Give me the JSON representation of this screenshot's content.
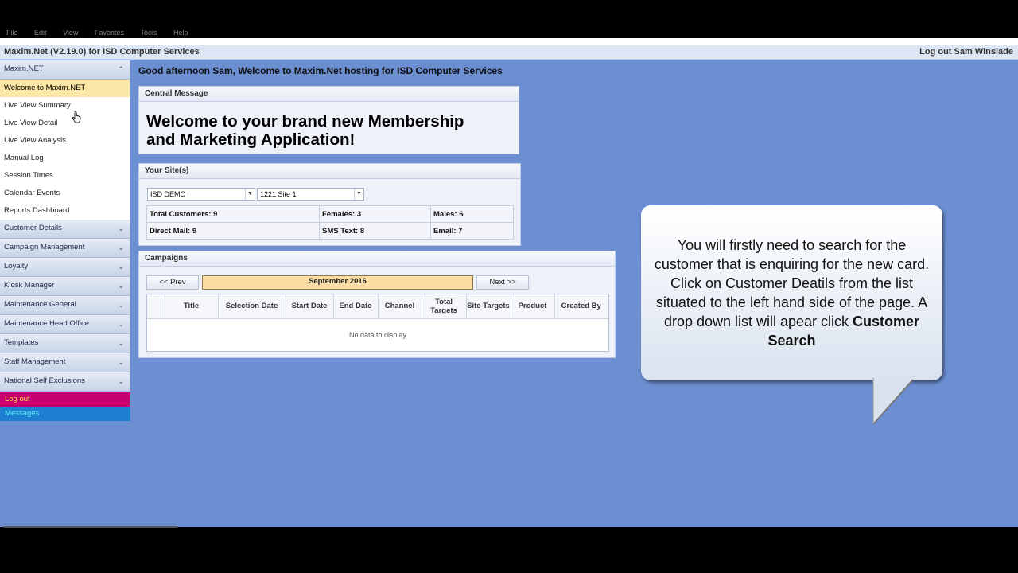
{
  "menubar": [
    "File",
    "Edit",
    "View",
    "Favorites",
    "Tools",
    "Help"
  ],
  "header": {
    "title": "Maxim.Net (V2.19.0) for ISD Computer Services",
    "logout": "Log out Sam Winslade"
  },
  "sidebar": {
    "group_main": "Maxim.NET",
    "items": [
      "Welcome to Maxim.NET",
      "Live View Summary",
      "Live View Detail",
      "Live View Analysis",
      "Manual Log",
      "Session Times",
      "Calendar Events",
      "Reports Dashboard"
    ],
    "active_item": "Welcome to Maxim.NET",
    "groups": [
      "Customer Details",
      "Campaign Management",
      "Loyalty",
      "Kiosk Manager",
      "Maintenance General",
      "Maintenance Head Office",
      "Templates",
      "Staff Management",
      "National Self Exclusions"
    ],
    "logout": "Log out",
    "messages": "Messages"
  },
  "welcome_text": "Good afternoon Sam, Welcome to Maxim.Net hosting for ISD Computer Services",
  "central_message": {
    "title": "Central Message",
    "line1": "Welcome to your brand new Membership",
    "line2": "and Marketing Application!"
  },
  "sites": {
    "title": "Your Site(s)",
    "site_select": "ISD DEMO",
    "subsite_select": "1221 Site 1",
    "total_customers": "Total Customers: 9",
    "females": "Females: 3",
    "males": "Males: 6",
    "direct_mail": "Direct Mail: 9",
    "sms_text": "SMS Text: 8",
    "email": "Email: 7"
  },
  "campaigns": {
    "title": "Campaigns",
    "prev": "<< Prev",
    "month": "September 2016",
    "next": "Next >>",
    "columns": [
      "",
      "Title",
      "Selection Date",
      "Start Date",
      "End Date",
      "Channel",
      "Total Targets",
      "Site Targets",
      "Product",
      "Created By"
    ],
    "no_data": "No data to display"
  },
  "callout": {
    "text": "You will firstly need to search for the customer that is enquiring for the new card. Click on Customer Deatils from the list situated to the left hand side of the page. A drop down list will apear click ",
    "bold": "Customer Search"
  },
  "colors": {
    "background": "#6c8fd2",
    "active_item": "#fce7a6",
    "logout": "#c6006f",
    "messages": "#1e7fd0",
    "month_bar": "#fbdca2"
  }
}
